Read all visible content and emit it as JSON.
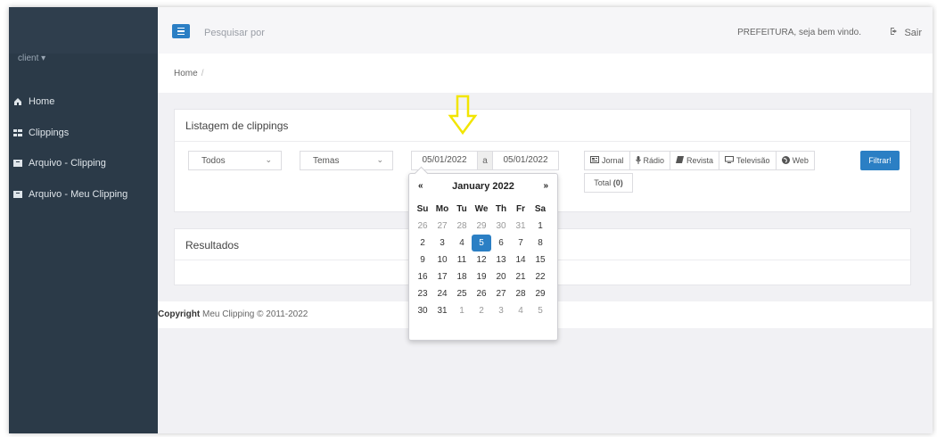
{
  "sidebar": {
    "user_label": "client ▾",
    "items": [
      {
        "label": "Home",
        "icon": "home-icon"
      },
      {
        "label": "Clippings",
        "icon": "grid-icon"
      },
      {
        "label": "Arquivo - Clipping",
        "icon": "archive-icon"
      },
      {
        "label": "Arquivo - Meu Clipping",
        "icon": "archive-icon"
      }
    ]
  },
  "topbar": {
    "search_placeholder": "Pesquisar por",
    "welcome": "PREFEITURA, seja bem vindo.",
    "logout_label": "Sair"
  },
  "breadcrumb": {
    "home": "Home",
    "separator": "/"
  },
  "listing": {
    "title": "Listagem de clippings",
    "select_type": "Todos",
    "select_theme": "Temas",
    "date_from": "05/01/2022",
    "date_sep": "a",
    "date_to": "05/01/2022",
    "media": [
      "Jornal",
      "Rádio",
      "Revista",
      "Televisão",
      "Web"
    ],
    "total_label": "Total",
    "total_count": "(0)",
    "filter_button": "Filtrar!"
  },
  "results": {
    "title": "Resultados"
  },
  "footer": {
    "bold": "Copyright",
    "text": "Meu Clipping © 2011-2022"
  },
  "datepicker": {
    "prev": "«",
    "next": "»",
    "month": "January 2022",
    "weekdays": [
      "Su",
      "Mo",
      "Tu",
      "We",
      "Th",
      "Fr",
      "Sa"
    ],
    "weeks": [
      [
        "26",
        "27",
        "28",
        "29",
        "30",
        "31",
        "1"
      ],
      [
        "2",
        "3",
        "4",
        "5",
        "6",
        "7",
        "8"
      ],
      [
        "9",
        "10",
        "11",
        "12",
        "13",
        "14",
        "15"
      ],
      [
        "16",
        "17",
        "18",
        "19",
        "20",
        "21",
        "22"
      ],
      [
        "23",
        "24",
        "25",
        "26",
        "27",
        "28",
        "29"
      ],
      [
        "30",
        "31",
        "1",
        "2",
        "3",
        "4",
        "5"
      ]
    ],
    "selected": "5",
    "accent": "#2b7fc4"
  },
  "colors": {
    "sidebar": "#2b3a48",
    "primary": "#2b7fc4",
    "annotation_arrow": "#f2e500"
  }
}
